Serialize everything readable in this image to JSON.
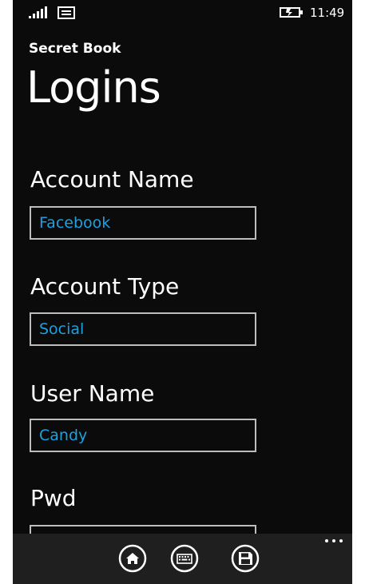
{
  "status_bar": {
    "time": "11:49"
  },
  "header": {
    "app_name": "Secret Book",
    "page_title": "Logins"
  },
  "form": {
    "account_name_label": "Account Name",
    "account_name_value": "Facebook",
    "account_type_label": "Account Type",
    "account_type_value": "Social",
    "user_name_label": "User Name",
    "user_name_value": "Candy",
    "pwd_label": "Pwd",
    "pwd_value": ""
  },
  "app_bar": {
    "buttons": [
      "home-icon",
      "keyboard-icon",
      "save-icon"
    ],
    "more": "ellipsis-icon"
  },
  "colors": {
    "background": "#0b0b0b",
    "accent": "#1ba1e2",
    "app_bar": "#1f1f1f",
    "field_border": "#bdbdbd"
  }
}
